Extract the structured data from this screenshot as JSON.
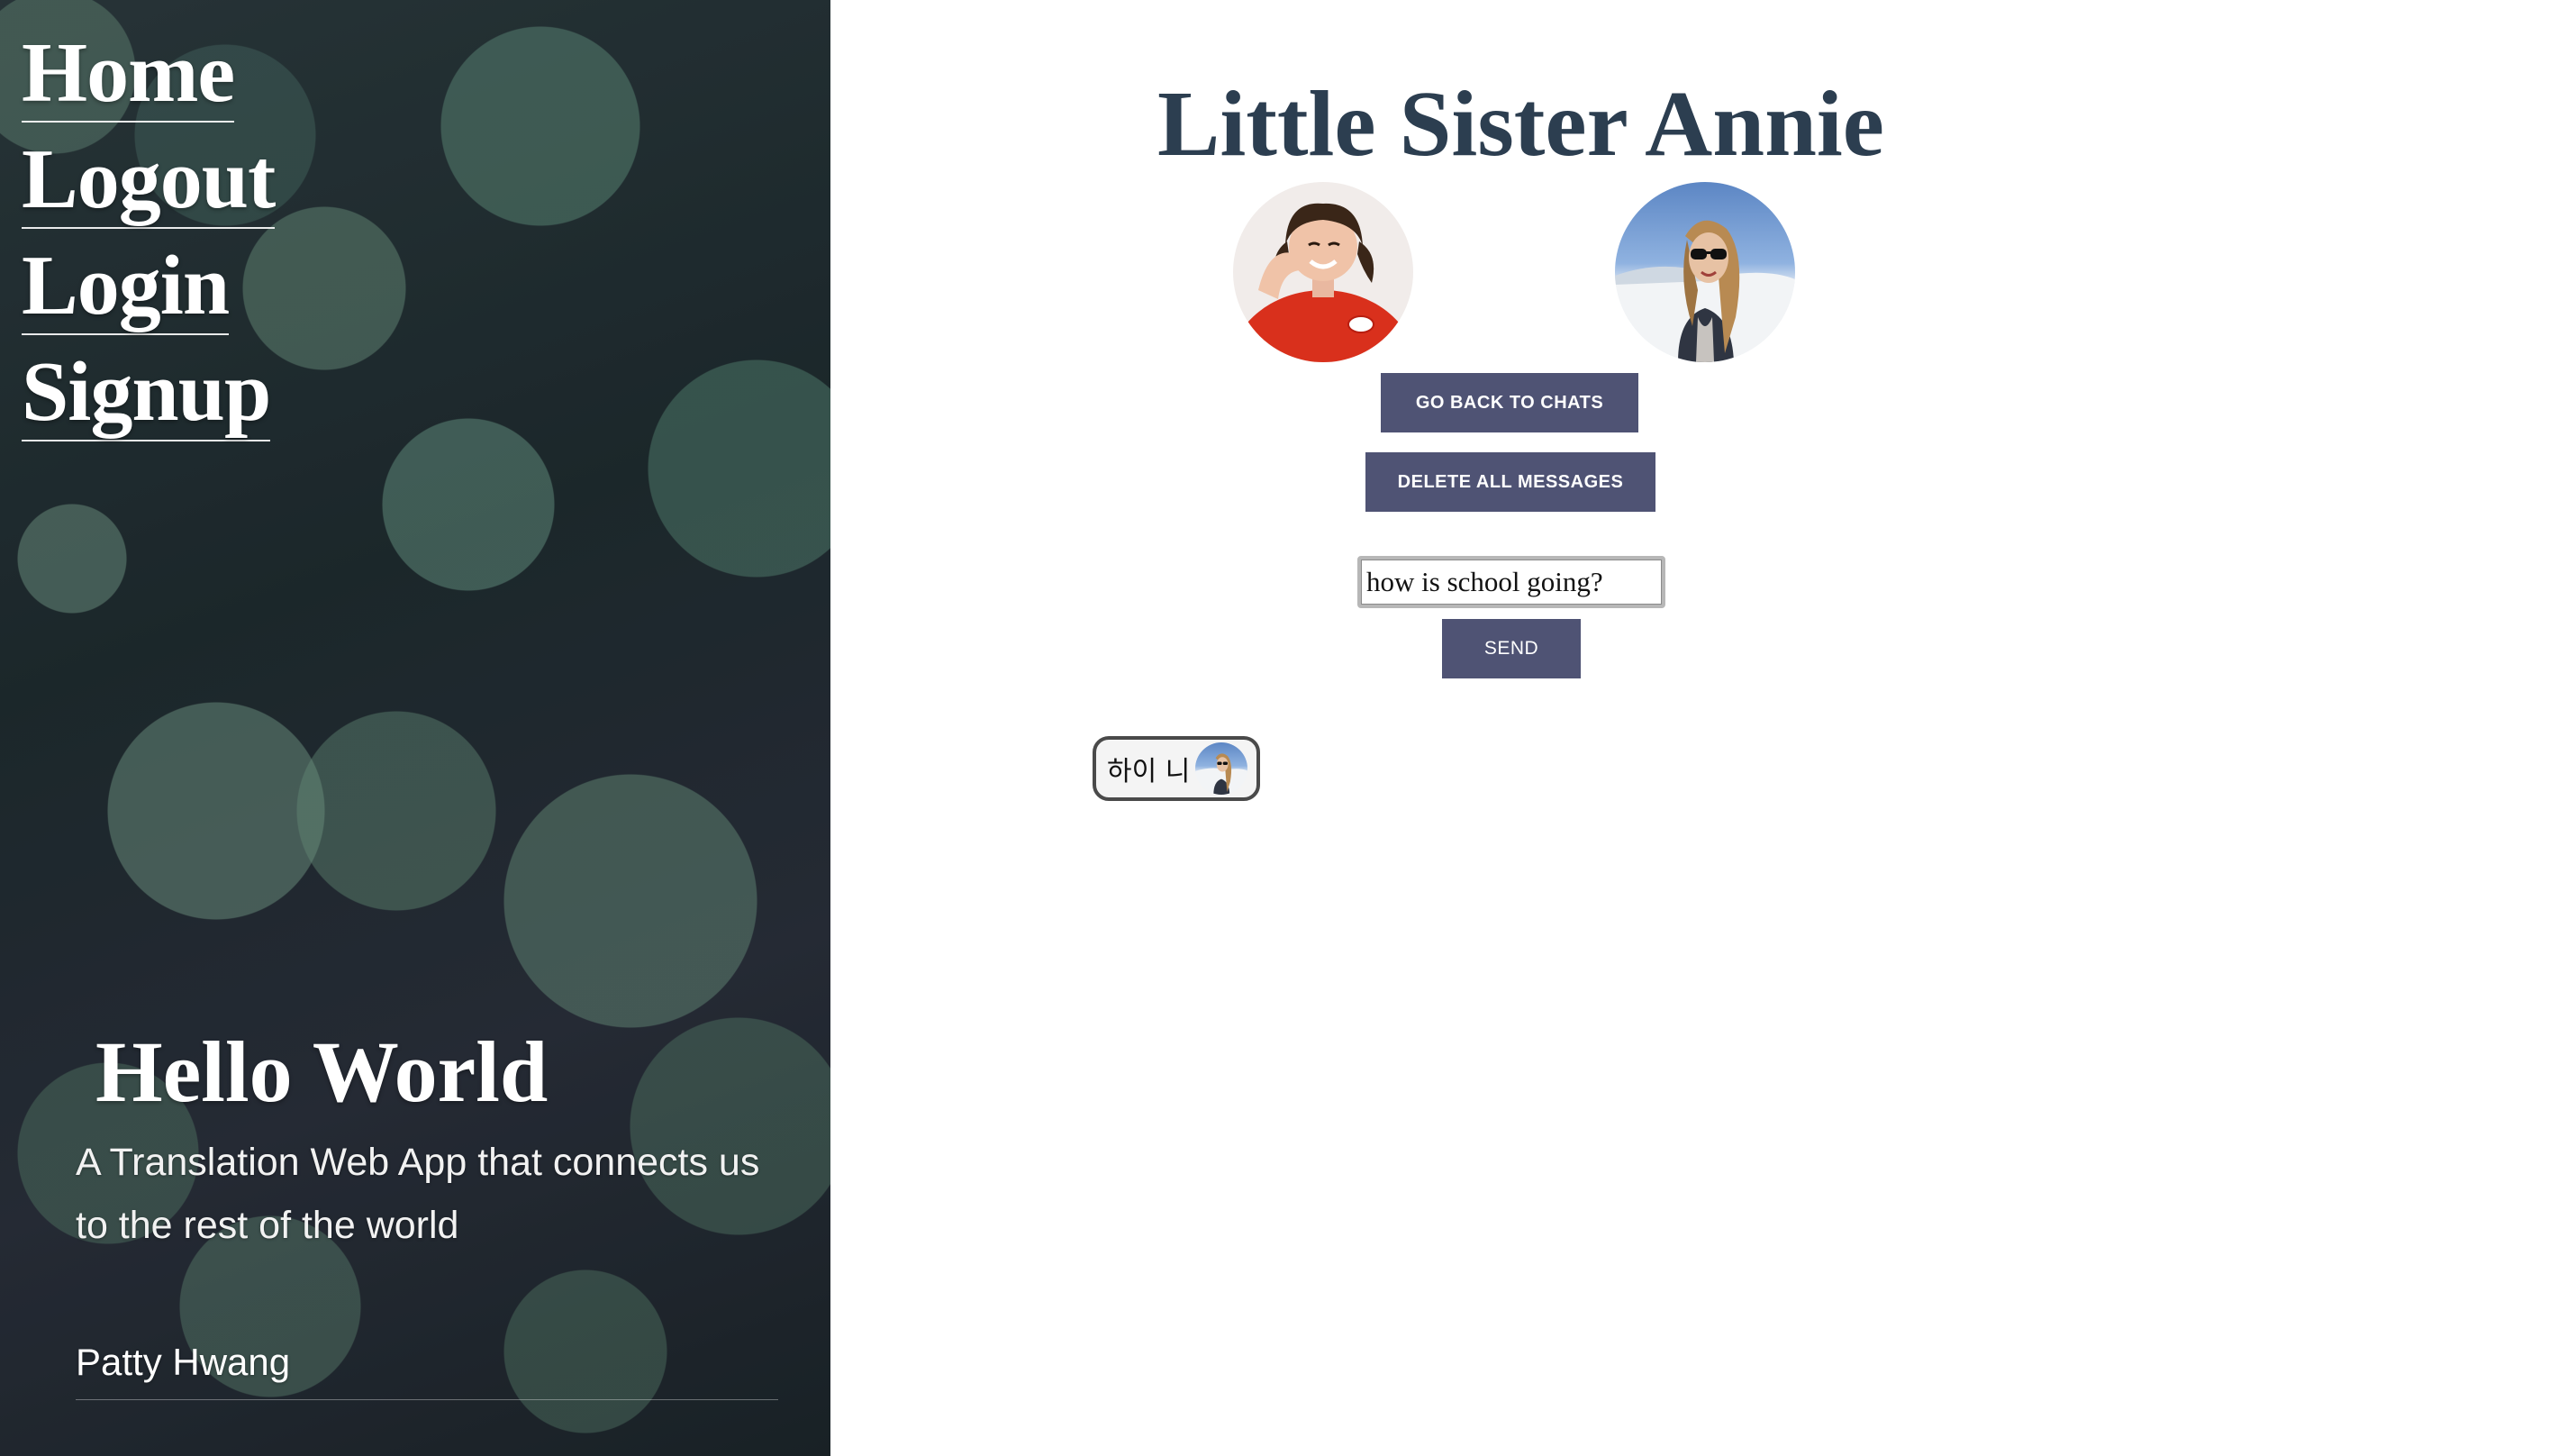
{
  "nav": {
    "items": [
      {
        "label": "Home"
      },
      {
        "label": "Logout"
      },
      {
        "label": "Login"
      },
      {
        "label": "Signup"
      }
    ]
  },
  "hero": {
    "title": "Hello World",
    "subtitle": "A Translation Web App that connects us to the rest of the world",
    "author": "Patty Hwang"
  },
  "chat": {
    "title": "Little Sister Annie",
    "back_button": "GO BACK TO CHATS",
    "delete_button": "DELETE ALL MESSAGES",
    "input_value": "how is school going?",
    "send_button": "SEND",
    "messages": [
      {
        "text": "하이 니"
      }
    ]
  },
  "colors": {
    "title": "#2c3e50",
    "button_bg": "#4f5374",
    "button_text": "#ffffff"
  }
}
